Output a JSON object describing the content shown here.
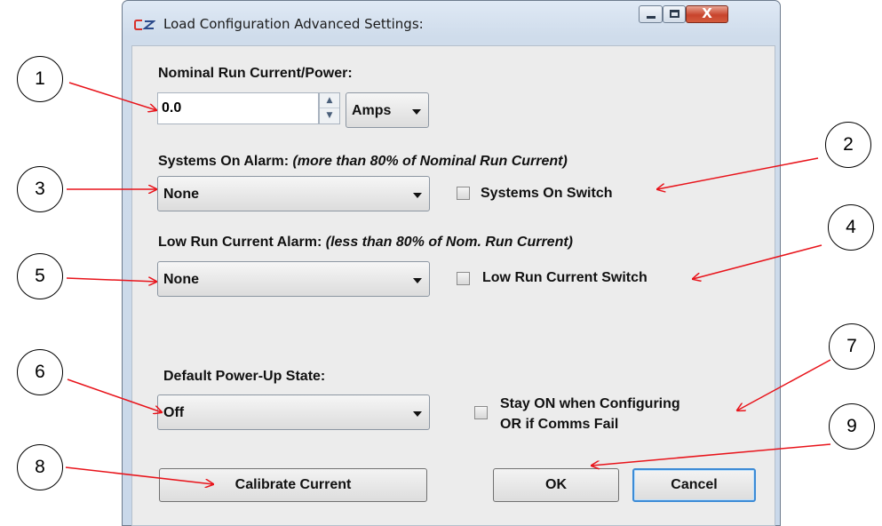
{
  "window": {
    "title": "Load Configuration Advanced Settings:",
    "app_icon": "cz-logo-icon",
    "close_glyph": "X"
  },
  "nominal": {
    "label": "Nominal Run Current/Power:",
    "value": "0.0",
    "unit": "Amps"
  },
  "systems_on": {
    "label": "Systems On Alarm:",
    "note": "(more than 80% of Nominal Run Current)",
    "selected": "None",
    "switch_label": "Systems On Switch"
  },
  "low_run": {
    "label": "Low Run Current Alarm:",
    "note": "(less than 80% of Nom. Run Current)",
    "selected": "None",
    "switch_label": "Low Run Current Switch"
  },
  "power_up": {
    "label": "Default Power-Up State:",
    "selected": "Off",
    "stay_on_line1": "Stay ON when Configuring",
    "stay_on_line2": "OR if Comms Fail"
  },
  "buttons": {
    "calibrate": "Calibrate Current",
    "ok": "OK",
    "cancel": "Cancel"
  },
  "callouts": [
    "1",
    "2",
    "3",
    "4",
    "5",
    "6",
    "7",
    "8",
    "9"
  ],
  "colors": {
    "annotation_arrow": "#e8141b",
    "default_button_border": "#3c8bd6",
    "title_bar": "#cfdceb"
  }
}
